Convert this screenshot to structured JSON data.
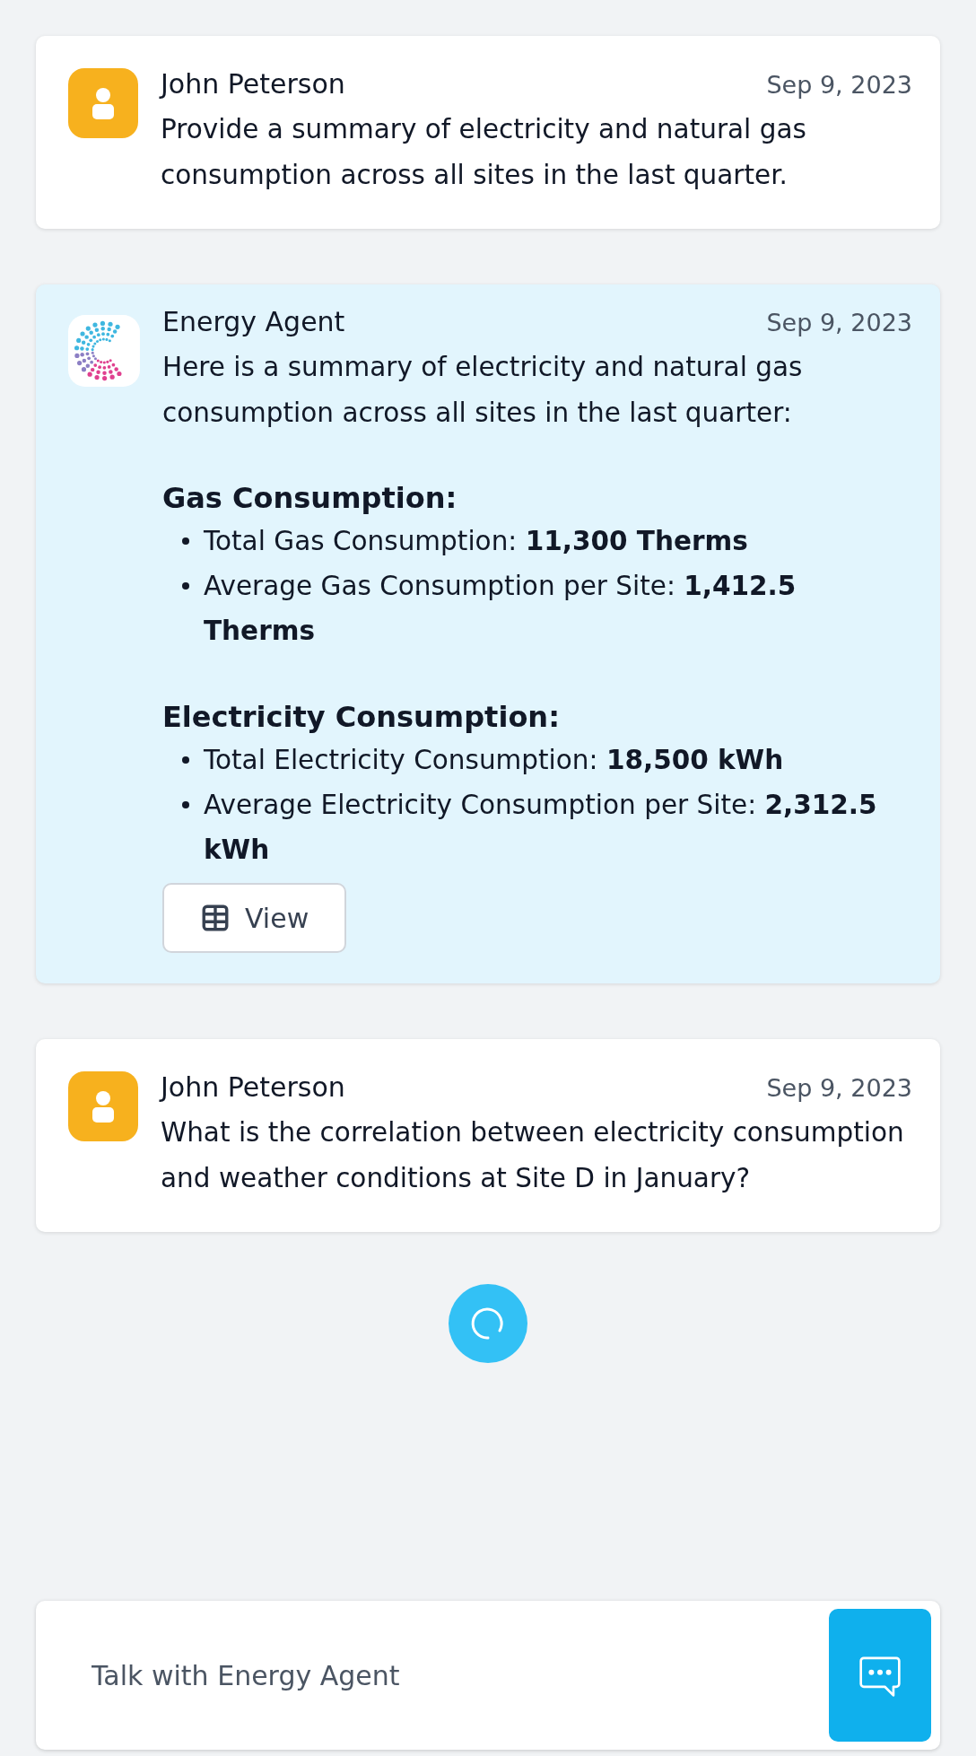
{
  "messages": [
    {
      "kind": "user",
      "author": "John Peterson",
      "date": "Sep 9, 2023",
      "text": "Provide a summary of electricity and natural gas consumption across all sites in the last quarter."
    },
    {
      "kind": "agent",
      "author": "Energy Agent",
      "date": "Sep 9, 2023",
      "text": "Here is a summary of electricity and natural gas consumption across all sites in the last quarter:",
      "sections": [
        {
          "heading": "Gas Consumption:",
          "items": [
            "Total Gas Consumption: **11,300 Therms**",
            "Average Gas Consumption per Site: **1,412.5 Therms**"
          ]
        },
        {
          "heading": "Electricity Consumption:",
          "items": [
            "Total Electricity Consumption: **18,500 kWh**",
            "Average Electricity Consumption per Site: **2,312.5 kWh**"
          ]
        }
      ],
      "button": {
        "label": "View"
      }
    },
    {
      "kind": "user",
      "author": "John Peterson",
      "date": "Sep 9, 2023",
      "text": "What is the correlation between electricity consumption and weather conditions at Site D in January?"
    }
  ],
  "loading": true,
  "composer": {
    "placeholder": "Talk with Energy Agent"
  }
}
